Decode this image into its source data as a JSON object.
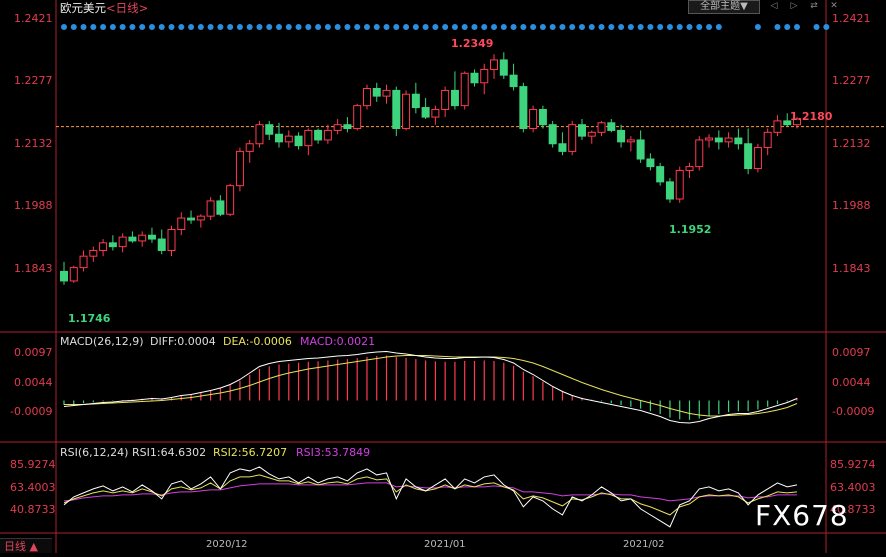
{
  "header": {
    "title": "欧元美元",
    "period": "<日线>",
    "topic_button": "全部主题▼"
  },
  "toolbar_icons": [
    "prev-icon",
    "next-icon",
    "swap-icon",
    "close-icon"
  ],
  "price_panel": {
    "left_axis": [
      "1.2421",
      "1.2277",
      "1.2132",
      "1.1988",
      "1.1843"
    ],
    "right_axis": [
      "1.2421",
      "1.2277",
      "1.2132",
      "1.1988",
      "1.1843"
    ],
    "annotations": {
      "high": "1.2349",
      "low1": "1.1746",
      "low2": "1.1952",
      "last": "1.2180"
    },
    "reference_price": 1.2155,
    "ylim": [
      1.17,
      1.244
    ]
  },
  "macd_panel": {
    "label": "MACD(26,12,9)",
    "diff_label": "DIFF:0.0004",
    "dea_label": "DEA:-0.0006",
    "macd_label": "MACD:0.0021",
    "axis": [
      "0.0097",
      "0.0044",
      "-0.0009"
    ]
  },
  "rsi_panel": {
    "label": "RSI(6,12,24)",
    "rsi1_label": "RSI1:64.6302",
    "rsi2_label": "RSI2:56.7207",
    "rsi3_label": "RSI3:53.7849",
    "axis": [
      "85.9274",
      "63.4003",
      "40.8733"
    ]
  },
  "x_axis": {
    "dates": [
      "2020/12",
      "2021/01",
      "2021/02"
    ]
  },
  "bottom_tab": "日线 ▲",
  "watermark": "FX678",
  "colors": {
    "up": "#ff3b4f",
    "down": "#3ed47e",
    "diff": "#ffffff",
    "dea": "#e8e25a",
    "rsi1": "#ffffff",
    "rsi2": "#e8e25a",
    "rsi3": "#d040e0",
    "ref": "#ff9a40",
    "dots": "#2a8fe0",
    "grid": "#b02030"
  },
  "chart_data": {
    "type": "candlestick",
    "title": "欧元美元 <日线>",
    "series": [
      {
        "name": "EURUSD",
        "ohlc": [
          [
            1.1775,
            1.18,
            1.174,
            1.175
          ],
          [
            1.175,
            1.179,
            1.1745,
            1.1785
          ],
          [
            1.1785,
            1.183,
            1.1775,
            1.1815
          ],
          [
            1.1815,
            1.184,
            1.18,
            1.183
          ],
          [
            1.183,
            1.186,
            1.1815,
            1.185
          ],
          [
            1.185,
            1.187,
            1.183,
            1.184
          ],
          [
            1.184,
            1.1875,
            1.1825,
            1.1865
          ],
          [
            1.1865,
            1.188,
            1.185,
            1.1855
          ],
          [
            1.1855,
            1.188,
            1.184,
            1.187
          ],
          [
            1.187,
            1.189,
            1.185,
            1.186
          ],
          [
            1.186,
            1.1885,
            1.182,
            1.183
          ],
          [
            1.183,
            1.1895,
            1.1815,
            1.1885
          ],
          [
            1.1885,
            1.193,
            1.187,
            1.1915
          ],
          [
            1.1915,
            1.1935,
            1.19,
            1.191
          ],
          [
            1.191,
            1.1925,
            1.189,
            1.192
          ],
          [
            1.192,
            1.197,
            1.191,
            1.196
          ],
          [
            1.196,
            1.1975,
            1.192,
            1.1925
          ],
          [
            1.1925,
            1.2005,
            1.192,
            1.2
          ],
          [
            1.2,
            1.21,
            1.1985,
            1.209
          ],
          [
            1.209,
            1.212,
            1.206,
            1.211
          ],
          [
            1.211,
            1.217,
            1.21,
            1.216
          ],
          [
            1.216,
            1.217,
            1.212,
            1.2135
          ],
          [
            1.2135,
            1.2165,
            1.21,
            1.2115
          ],
          [
            1.2115,
            1.2145,
            1.21,
            1.213
          ],
          [
            1.213,
            1.214,
            1.2095,
            1.2105
          ],
          [
            1.2105,
            1.215,
            1.208,
            1.2145
          ],
          [
            1.2145,
            1.215,
            1.211,
            1.212
          ],
          [
            1.212,
            1.216,
            1.211,
            1.2145
          ],
          [
            1.2145,
            1.2175,
            1.2135,
            1.216
          ],
          [
            1.216,
            1.218,
            1.214,
            1.215
          ],
          [
            1.215,
            1.2215,
            1.2145,
            1.221
          ],
          [
            1.221,
            1.2265,
            1.22,
            1.2255
          ],
          [
            1.2255,
            1.227,
            1.222,
            1.2235
          ],
          [
            1.2235,
            1.2265,
            1.2215,
            1.225
          ],
          [
            1.225,
            1.226,
            1.213,
            1.215
          ],
          [
            1.215,
            1.225,
            1.2145,
            1.224
          ],
          [
            1.224,
            1.227,
            1.219,
            1.2205
          ],
          [
            1.2205,
            1.223,
            1.2175,
            1.218
          ],
          [
            1.218,
            1.221,
            1.216,
            1.22
          ],
          [
            1.22,
            1.226,
            1.218,
            1.225
          ],
          [
            1.225,
            1.23,
            1.22,
            1.221
          ],
          [
            1.221,
            1.23,
            1.22,
            1.2295
          ],
          [
            1.2295,
            1.2305,
            1.226,
            1.227
          ],
          [
            1.227,
            1.232,
            1.224,
            1.2305
          ],
          [
            1.2305,
            1.2345,
            1.228,
            1.233
          ],
          [
            1.233,
            1.235,
            1.228,
            1.229
          ],
          [
            1.229,
            1.232,
            1.225,
            1.226
          ],
          [
            1.226,
            1.227,
            1.214,
            1.215
          ],
          [
            1.215,
            1.221,
            1.214,
            1.22
          ],
          [
            1.22,
            1.221,
            1.215,
            1.216
          ],
          [
            1.216,
            1.217,
            1.21,
            1.211
          ],
          [
            1.211,
            1.214,
            1.208,
            1.209
          ],
          [
            1.209,
            1.217,
            1.208,
            1.216
          ],
          [
            1.216,
            1.2175,
            1.212,
            1.213
          ],
          [
            1.213,
            1.2145,
            1.211,
            1.214
          ],
          [
            1.214,
            1.217,
            1.213,
            1.2165
          ],
          [
            1.2165,
            1.2175,
            1.214,
            1.2145
          ],
          [
            1.2145,
            1.216,
            1.21,
            1.2115
          ],
          [
            1.2115,
            1.213,
            1.209,
            1.212
          ],
          [
            1.212,
            1.2145,
            1.206,
            1.207
          ],
          [
            1.207,
            1.2085,
            1.204,
            1.205
          ],
          [
            1.205,
            1.206,
            1.2,
            1.201
          ],
          [
            1.201,
            1.202,
            1.1955,
            1.1965
          ],
          [
            1.1965,
            1.205,
            1.1955,
            1.204
          ],
          [
            1.204,
            1.206,
            1.202,
            1.205
          ],
          [
            1.205,
            1.213,
            1.204,
            1.212
          ],
          [
            1.212,
            1.2135,
            1.21,
            1.2125
          ],
          [
            1.2125,
            1.2145,
            1.2095,
            1.2115
          ],
          [
            1.2115,
            1.214,
            1.21,
            1.2125
          ],
          [
            1.2125,
            1.215,
            1.2095,
            1.211
          ],
          [
            1.211,
            1.215,
            1.203,
            1.2045
          ],
          [
            1.2045,
            1.211,
            1.2035,
            1.21
          ],
          [
            1.21,
            1.215,
            1.208,
            1.214
          ],
          [
            1.214,
            1.2185,
            1.213,
            1.217
          ],
          [
            1.217,
            1.219,
            1.2155,
            1.216
          ],
          [
            1.216,
            1.218,
            1.215,
            1.2175
          ]
        ]
      }
    ],
    "macd": {
      "diff": [
        -0.0012,
        -0.001,
        -0.0008,
        -0.0006,
        -0.0004,
        -0.0003,
        -0.0001,
        0.0,
        0.0002,
        0.0004,
        0.0003,
        0.0006,
        0.001,
        0.0012,
        0.0016,
        0.002,
        0.0025,
        0.0032,
        0.0042,
        0.0055,
        0.0068,
        0.0074,
        0.0078,
        0.008,
        0.0082,
        0.0084,
        0.0085,
        0.0087,
        0.0089,
        0.009,
        0.0092,
        0.0095,
        0.0097,
        0.0098,
        0.0095,
        0.0093,
        0.009,
        0.0087,
        0.0085,
        0.0084,
        0.0084,
        0.0086,
        0.0086,
        0.0087,
        0.0086,
        0.0082,
        0.0075,
        0.0062,
        0.0052,
        0.004,
        0.0028,
        0.0018,
        0.001,
        0.0004,
        0.0,
        -0.0004,
        -0.0008,
        -0.0012,
        -0.0016,
        -0.002,
        -0.0026,
        -0.0032,
        -0.004,
        -0.0044,
        -0.0045,
        -0.0042,
        -0.0036,
        -0.0032,
        -0.0028,
        -0.0026,
        -0.0026,
        -0.0022,
        -0.0016,
        -0.001,
        -0.0004,
        0.0004
      ],
      "dea": [
        -0.0008,
        -0.0008,
        -0.0008,
        -0.0007,
        -0.0006,
        -0.0005,
        -0.0004,
        -0.0003,
        -0.0002,
        -0.0001,
        0.0,
        0.0002,
        0.0004,
        0.0006,
        0.0009,
        0.0012,
        0.0015,
        0.0019,
        0.0024,
        0.003,
        0.0037,
        0.0044,
        0.005,
        0.0055,
        0.0059,
        0.0063,
        0.0066,
        0.0069,
        0.0072,
        0.0075,
        0.0078,
        0.0081,
        0.0084,
        0.0087,
        0.0089,
        0.009,
        0.009,
        0.009,
        0.0089,
        0.0088,
        0.0087,
        0.0087,
        0.0087,
        0.0087,
        0.0087,
        0.0086,
        0.0084,
        0.008,
        0.0075,
        0.0068,
        0.006,
        0.0052,
        0.0044,
        0.0036,
        0.0029,
        0.0022,
        0.0016,
        0.001,
        0.0005,
        0.0,
        -0.0005,
        -0.001,
        -0.0016,
        -0.0021,
        -0.0026,
        -0.0029,
        -0.0031,
        -0.0031,
        -0.003,
        -0.0029,
        -0.0028,
        -0.0026,
        -0.0023,
        -0.0019,
        -0.0014,
        -0.0006
      ]
    },
    "rsi": {
      "rsi1": [
        44,
        52,
        56,
        60,
        63,
        58,
        62,
        57,
        64,
        58,
        50,
        65,
        68,
        60,
        65,
        72,
        60,
        76,
        80,
        78,
        82,
        75,
        70,
        72,
        66,
        72,
        66,
        70,
        72,
        68,
        76,
        80,
        74,
        76,
        50,
        70,
        62,
        58,
        64,
        70,
        60,
        70,
        66,
        72,
        74,
        64,
        58,
        42,
        52,
        48,
        40,
        34,
        52,
        48,
        54,
        62,
        56,
        48,
        50,
        40,
        34,
        28,
        22,
        44,
        48,
        60,
        62,
        58,
        60,
        56,
        44,
        54,
        60,
        66,
        62,
        64
      ],
      "rsi2": [
        46,
        50,
        53,
        56,
        58,
        56,
        58,
        56,
        60,
        57,
        53,
        60,
        62,
        59,
        61,
        66,
        60,
        68,
        72,
        72,
        74,
        71,
        68,
        68,
        65,
        67,
        64,
        66,
        67,
        65,
        70,
        72,
        69,
        70,
        57,
        64,
        60,
        58,
        60,
        64,
        60,
        64,
        62,
        65,
        66,
        62,
        59,
        50,
        53,
        51,
        47,
        43,
        50,
        49,
        52,
        56,
        54,
        50,
        50,
        45,
        42,
        38,
        34,
        42,
        45,
        52,
        54,
        53,
        54,
        52,
        46,
        50,
        53,
        57,
        56,
        57
      ],
      "rsi3": [
        48,
        49,
        51,
        52,
        53,
        53,
        54,
        54,
        55,
        55,
        54,
        56,
        57,
        57,
        58,
        59,
        59,
        61,
        63,
        64,
        65,
        65,
        65,
        65,
        64,
        64,
        64,
        64,
        64,
        64,
        65,
        66,
        66,
        66,
        62,
        63,
        62,
        61,
        61,
        62,
        61,
        62,
        62,
        62,
        63,
        62,
        61,
        57,
        57,
        56,
        55,
        53,
        54,
        54,
        54,
        55,
        55,
        54,
        54,
        52,
        51,
        50,
        48,
        49,
        50,
        52,
        53,
        53,
        53,
        53,
        51,
        52,
        52,
        54,
        54,
        54
      ]
    }
  }
}
